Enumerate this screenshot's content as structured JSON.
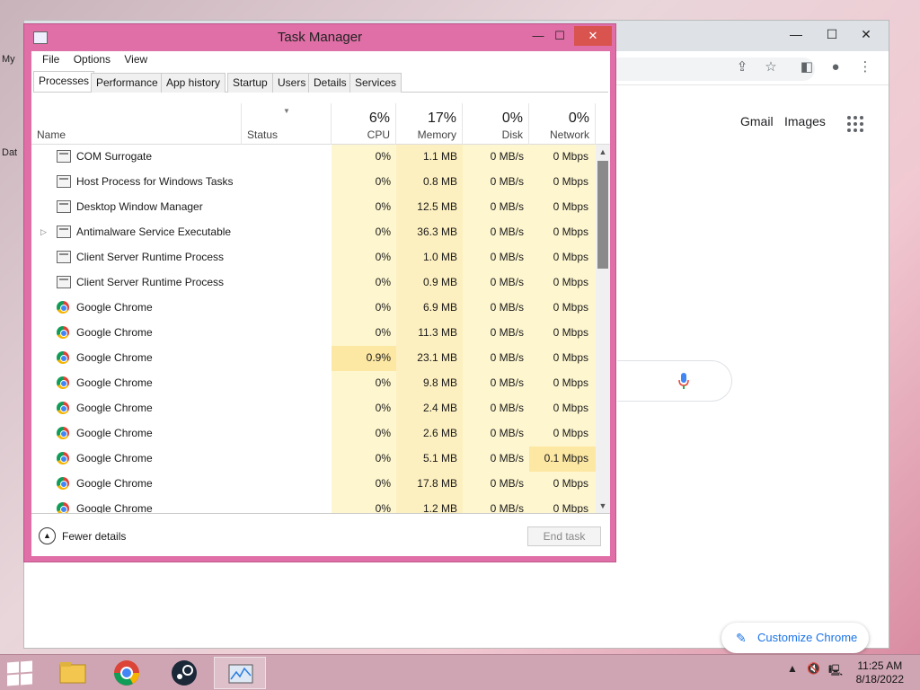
{
  "desktop": {
    "icons": [
      {
        "label": "My"
      },
      {
        "label": "Dat"
      }
    ]
  },
  "chrome": {
    "links": {
      "gmail": "Gmail",
      "images": "Images"
    },
    "customize_label": "Customize Chrome"
  },
  "task_manager": {
    "title": "Task Manager",
    "menu": [
      "File",
      "Options",
      "View"
    ],
    "tabs": [
      "Processes",
      "Performance",
      "App history",
      "Startup",
      "Users",
      "Details",
      "Services"
    ],
    "active_tab": "Processes",
    "columns": {
      "name": "Name",
      "status": "Status",
      "cpu": {
        "pct": "6%",
        "label": "CPU"
      },
      "memory": {
        "pct": "17%",
        "label": "Memory"
      },
      "disk": {
        "pct": "0%",
        "label": "Disk"
      },
      "network": {
        "pct": "0%",
        "label": "Network"
      }
    },
    "rows": [
      {
        "icon": "process-icon",
        "name": "COM Surrogate",
        "cpu": "0%",
        "memory": "1.1 MB",
        "disk": "0 MB/s",
        "network": "0 Mbps"
      },
      {
        "icon": "process-icon",
        "name": "Host Process for Windows Tasks",
        "cpu": "0%",
        "memory": "0.8 MB",
        "disk": "0 MB/s",
        "network": "0 Mbps"
      },
      {
        "icon": "process-icon",
        "name": "Desktop Window Manager",
        "cpu": "0%",
        "memory": "12.5 MB",
        "disk": "0 MB/s",
        "network": "0 Mbps"
      },
      {
        "icon": "process-icon",
        "name": "Antimalware Service Executable",
        "cpu": "0%",
        "memory": "36.3 MB",
        "disk": "0 MB/s",
        "network": "0 Mbps",
        "expandable": true
      },
      {
        "icon": "process-icon",
        "name": "Client Server Runtime Process",
        "cpu": "0%",
        "memory": "1.0 MB",
        "disk": "0 MB/s",
        "network": "0 Mbps"
      },
      {
        "icon": "process-icon",
        "name": "Client Server Runtime Process",
        "cpu": "0%",
        "memory": "0.9 MB",
        "disk": "0 MB/s",
        "network": "0 Mbps"
      },
      {
        "icon": "chrome-icon",
        "name": "Google Chrome",
        "cpu": "0%",
        "memory": "6.9 MB",
        "disk": "0 MB/s",
        "network": "0 Mbps"
      },
      {
        "icon": "chrome-icon",
        "name": "Google Chrome",
        "cpu": "0%",
        "memory": "11.3 MB",
        "disk": "0 MB/s",
        "network": "0 Mbps"
      },
      {
        "icon": "chrome-icon",
        "name": "Google Chrome",
        "cpu": "0.9%",
        "memory": "23.1 MB",
        "disk": "0 MB/s",
        "network": "0 Mbps",
        "cpu_highlight": true
      },
      {
        "icon": "chrome-icon",
        "name": "Google Chrome",
        "cpu": "0%",
        "memory": "9.8 MB",
        "disk": "0 MB/s",
        "network": "0 Mbps"
      },
      {
        "icon": "chrome-icon",
        "name": "Google Chrome",
        "cpu": "0%",
        "memory": "2.4 MB",
        "disk": "0 MB/s",
        "network": "0 Mbps"
      },
      {
        "icon": "chrome-icon",
        "name": "Google Chrome",
        "cpu": "0%",
        "memory": "2.6 MB",
        "disk": "0 MB/s",
        "network": "0 Mbps"
      },
      {
        "icon": "chrome-icon",
        "name": "Google Chrome",
        "cpu": "0%",
        "memory": "5.1 MB",
        "disk": "0 MB/s",
        "network": "0.1 Mbps",
        "net_highlight": true
      },
      {
        "icon": "chrome-icon",
        "name": "Google Chrome",
        "cpu": "0%",
        "memory": "17.8 MB",
        "disk": "0 MB/s",
        "network": "0 Mbps"
      },
      {
        "icon": "chrome-icon",
        "name": "Google Chrome",
        "cpu": "0%",
        "memory": "1.2 MB",
        "disk": "0 MB/s",
        "network": "0 Mbps"
      }
    ],
    "footer": {
      "fewer_details": "Fewer details",
      "end_task": "End task"
    }
  },
  "taskbar": {
    "items": [
      "file-explorer-icon",
      "chrome-icon",
      "steam-icon",
      "task-manager-icon"
    ],
    "clock": {
      "time": "11:25 AM",
      "date": "8/18/2022"
    }
  },
  "colors": {
    "title_accent": "#df6fa6",
    "cpu_col": "#fef6cf",
    "mem_col": "#fdf0c0",
    "highlight": "#fce7a3"
  }
}
